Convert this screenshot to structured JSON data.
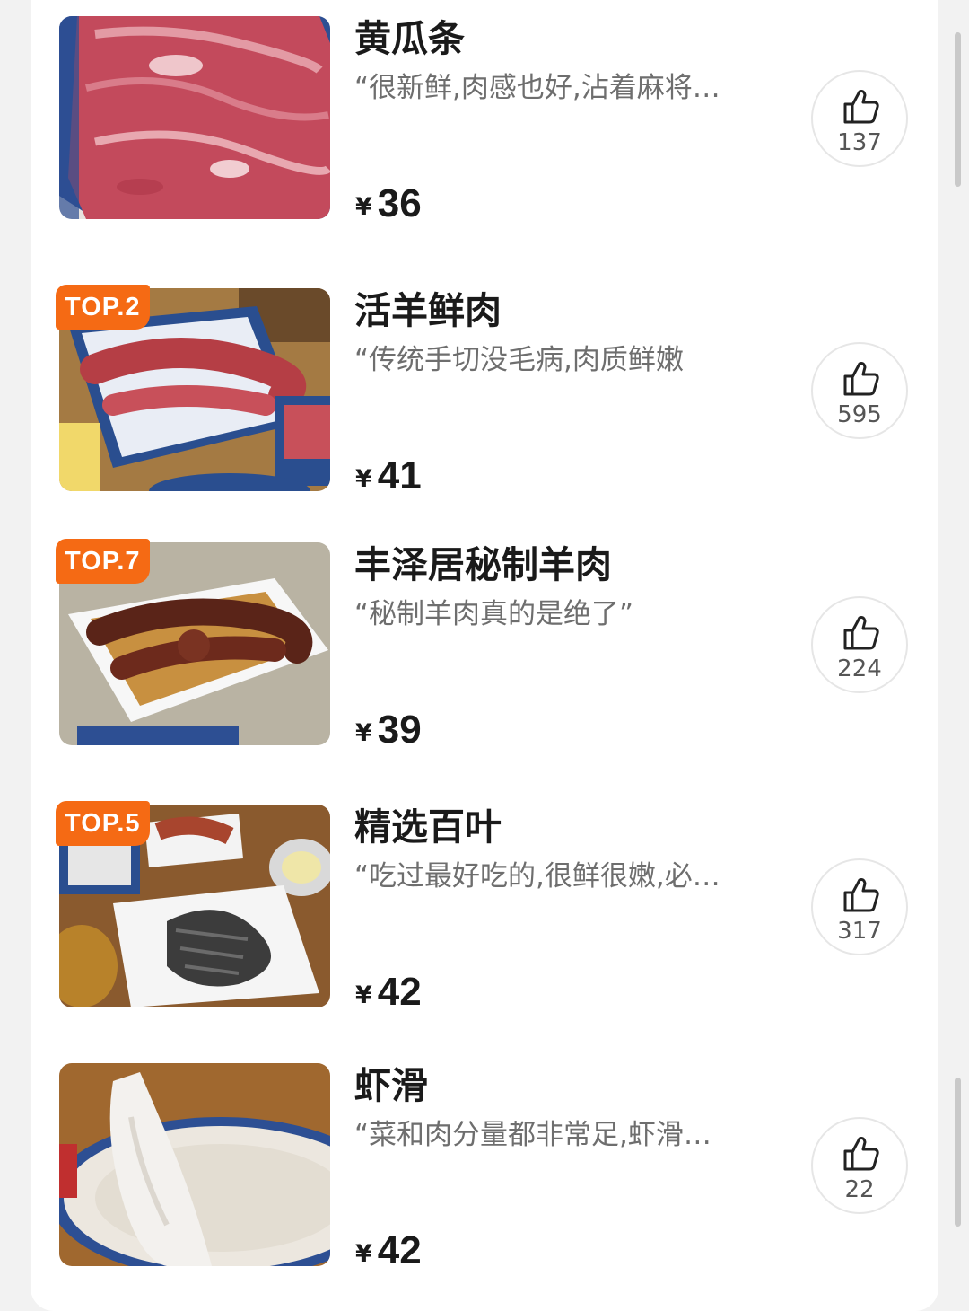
{
  "dishes": [
    {
      "name": "黄瓜条",
      "quote": "“很新鲜,肉感也好,沾着麻将…",
      "currency": "¥",
      "price": "36",
      "likes": "137",
      "badge": "",
      "image": "raw-beef-slices-photo"
    },
    {
      "name": "活羊鲜肉",
      "quote": "“传统手切没毛病,肉质鲜嫩",
      "currency": "¥",
      "price": "41",
      "likes": "595",
      "badge": "TOP.2",
      "image": "hand-cut-lamb-photo"
    },
    {
      "name": "丰泽居秘制羊肉",
      "quote": "“秘制羊肉真的是绝了”",
      "currency": "¥",
      "price": "39",
      "likes": "224",
      "badge": "TOP.7",
      "image": "marinated-lamb-photo"
    },
    {
      "name": "精选百叶",
      "quote": "“吃过最好吃的,很鲜很嫩,必…",
      "currency": "¥",
      "price": "42",
      "likes": "317",
      "badge": "TOP.5",
      "image": "tripe-photo"
    },
    {
      "name": "虾滑",
      "quote": "“菜和肉分量都非常足,虾滑…",
      "currency": "¥",
      "price": "42",
      "likes": "22",
      "badge": "",
      "image": "shrimp-paste-photo"
    }
  ],
  "icons": {
    "like": "thumbs-up-icon"
  },
  "colors": {
    "badge": "#f56a14",
    "title": "#1a1a1a",
    "quote": "#6e6e6e"
  }
}
